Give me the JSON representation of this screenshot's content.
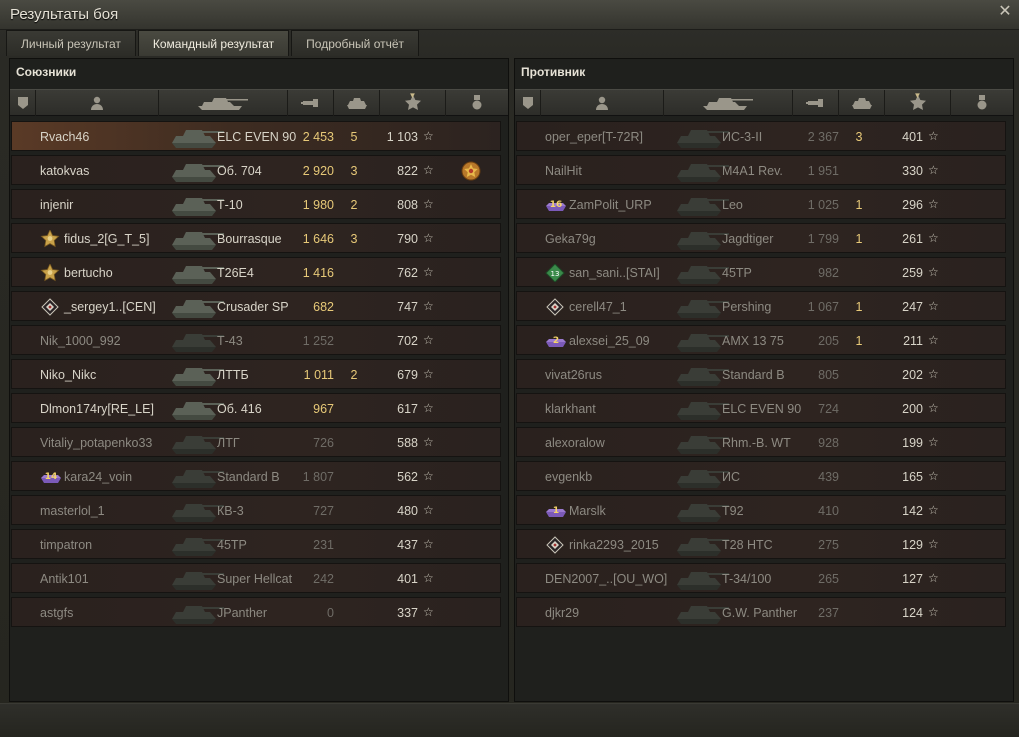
{
  "window": {
    "title": "Результаты боя",
    "close_glyph": "✕"
  },
  "tabs": [
    {
      "label": "Личный результат",
      "active": false
    },
    {
      "label": "Командный результат",
      "active": true
    },
    {
      "label": "Подробный отчёт",
      "active": false
    }
  ],
  "columns": {
    "icons": [
      "tank-icon",
      "player-icon",
      "vehicle-icon",
      "damage-icon",
      "frags-icon",
      "xp-star-icon",
      "medal-icon"
    ],
    "sorted_by": "xp"
  },
  "allies": {
    "title": "Союзники",
    "rows": [
      {
        "name": "Rvach46",
        "vehicle": "ELC EVEN 90",
        "damage": "2 453",
        "kills": "5",
        "xp": "1 103",
        "self": true,
        "dead": false,
        "badge": null,
        "medal": false
      },
      {
        "name": "katokvas",
        "vehicle": "Об. 704",
        "damage": "2 920",
        "kills": "3",
        "xp": "822",
        "self": false,
        "dead": false,
        "badge": null,
        "medal": true
      },
      {
        "name": "injenir",
        "vehicle": "Т-10",
        "damage": "1 980",
        "kills": "2",
        "xp": "808",
        "self": false,
        "dead": false,
        "badge": null,
        "medal": false
      },
      {
        "name": "fidus_2[G_T_5]",
        "vehicle": "Bourrasque",
        "damage": "1 646",
        "kills": "3",
        "xp": "790",
        "self": false,
        "dead": false,
        "badge": "gold-star",
        "medal": false
      },
      {
        "name": "bertucho",
        "vehicle": "T26E4",
        "damage": "1 416",
        "kills": "",
        "xp": "762",
        "self": false,
        "dead": false,
        "badge": "gold-star",
        "medal": false
      },
      {
        "name": "_sergey1..[CEN]",
        "vehicle": "Crusader SP",
        "damage": "682",
        "kills": "",
        "xp": "747",
        "self": false,
        "dead": false,
        "badge": "diamond",
        "medal": false
      },
      {
        "name": "Nik_1000_992",
        "vehicle": "Т-43",
        "damage": "1 252",
        "kills": "",
        "xp": "702",
        "self": false,
        "dead": true,
        "badge": null,
        "medal": false
      },
      {
        "name": "Niko_Nikc",
        "vehicle": "ЛТТБ",
        "damage": "1 011",
        "kills": "2",
        "xp": "679",
        "self": false,
        "dead": false,
        "badge": null,
        "medal": false
      },
      {
        "name": "Dlmon174ry[RE_LE]",
        "vehicle": "Об. 416",
        "damage": "967",
        "kills": "",
        "xp": "617",
        "self": false,
        "dead": false,
        "badge": null,
        "medal": false
      },
      {
        "name": "Vitaliy_potapenko33",
        "vehicle": "ЛТГ",
        "damage": "726",
        "kills": "",
        "xp": "588",
        "self": false,
        "dead": true,
        "badge": null,
        "medal": false
      },
      {
        "name": "kara24_voin",
        "vehicle": "Standard B",
        "damage": "1 807",
        "kills": "",
        "xp": "562",
        "self": false,
        "dead": true,
        "badge": "rank-14",
        "medal": false
      },
      {
        "name": "masterlol_1",
        "vehicle": "КВ-3",
        "damage": "727",
        "kills": "",
        "xp": "480",
        "self": false,
        "dead": true,
        "badge": null,
        "medal": false
      },
      {
        "name": "timpatron",
        "vehicle": "45TP",
        "damage": "231",
        "kills": "",
        "xp": "437",
        "self": false,
        "dead": true,
        "badge": null,
        "medal": false
      },
      {
        "name": "Antik101",
        "vehicle": "Super Hellcat",
        "damage": "242",
        "kills": "",
        "xp": "401",
        "self": false,
        "dead": true,
        "badge": null,
        "medal": false
      },
      {
        "name": "astgfs",
        "vehicle": "JPanther",
        "damage": "0",
        "kills": "",
        "xp": "337",
        "self": false,
        "dead": true,
        "badge": null,
        "medal": false
      }
    ]
  },
  "enemies": {
    "title": "Противник",
    "rows": [
      {
        "name": "oper_eper[T-72R]",
        "vehicle": "ИС-3-II",
        "damage": "2 367",
        "kills": "3",
        "xp": "401",
        "dead": true,
        "badge": null
      },
      {
        "name": "NailHit",
        "vehicle": "M4A1 Rev.",
        "damage": "1 951",
        "kills": "",
        "xp": "330",
        "dead": true,
        "badge": null
      },
      {
        "name": "ZamPolit_URP",
        "vehicle": "Leo",
        "damage": "1 025",
        "kills": "1",
        "xp": "296",
        "dead": true,
        "badge": "rank-16"
      },
      {
        "name": "Geka79g",
        "vehicle": "Jagdtiger",
        "damage": "1 799",
        "kills": "1",
        "xp": "261",
        "dead": true,
        "badge": null
      },
      {
        "name": "san_sani..[STAI]",
        "vehicle": "45TP",
        "damage": "982",
        "kills": "",
        "xp": "259",
        "dead": true,
        "badge": "green-13"
      },
      {
        "name": "cerell47_1",
        "vehicle": "Pershing",
        "damage": "1 067",
        "kills": "1",
        "xp": "247",
        "dead": true,
        "badge": "diamond"
      },
      {
        "name": "alexsei_25_09",
        "vehicle": "AMX 13 75",
        "damage": "205",
        "kills": "1",
        "xp": "211",
        "dead": true,
        "badge": "rank-2"
      },
      {
        "name": "vivat26rus",
        "vehicle": "Standard B",
        "damage": "805",
        "kills": "",
        "xp": "202",
        "dead": true,
        "badge": null
      },
      {
        "name": "klarkhant",
        "vehicle": "ELC EVEN 90",
        "damage": "724",
        "kills": "",
        "xp": "200",
        "dead": true,
        "badge": null
      },
      {
        "name": "alexoralow",
        "vehicle": "Rhm.-B. WT",
        "damage": "928",
        "kills": "",
        "xp": "199",
        "dead": true,
        "badge": null
      },
      {
        "name": "evgenkb",
        "vehicle": "ИС",
        "damage": "439",
        "kills": "",
        "xp": "165",
        "dead": true,
        "badge": null
      },
      {
        "name": "Marslk",
        "vehicle": "T92",
        "damage": "410",
        "kills": "",
        "xp": "142",
        "dead": true,
        "badge": "rank-1"
      },
      {
        "name": "rinka2293_2015",
        "vehicle": "T28 HTC",
        "damage": "275",
        "kills": "",
        "xp": "129",
        "dead": true,
        "badge": "diamond"
      },
      {
        "name": "DEN2007_..[OU_WO]",
        "vehicle": "T-34/100",
        "damage": "265",
        "kills": "",
        "xp": "127",
        "dead": true,
        "badge": null
      },
      {
        "name": "djkr29",
        "vehicle": "G.W. Panther",
        "damage": "237",
        "kills": "",
        "xp": "124",
        "dead": true,
        "badge": null
      }
    ]
  },
  "colors": {
    "damage": "#e7c978",
    "text": "#d8d4c8",
    "dim": "#8d8a82",
    "self_row": "#5a3a26"
  }
}
